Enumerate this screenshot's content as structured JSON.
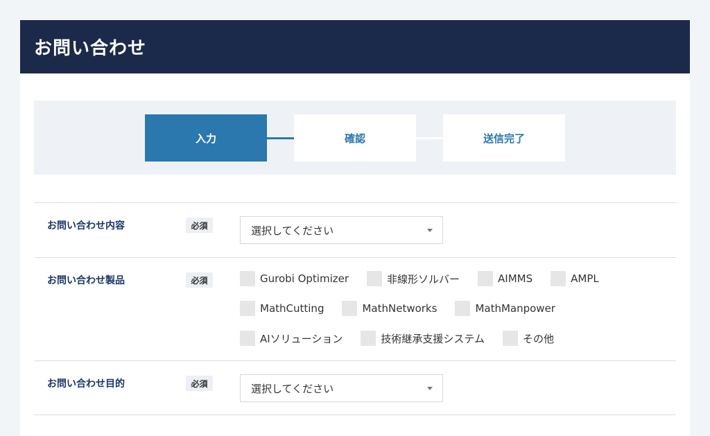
{
  "page": {
    "title": "お問い合わせ"
  },
  "colors": {
    "header_bg": "#1b2a4a",
    "accent": "#2a78ad",
    "label": "#1b3668"
  },
  "steps": [
    {
      "label": "入力",
      "active": true
    },
    {
      "label": "確認",
      "active": false
    },
    {
      "label": "送信完了",
      "active": false
    }
  ],
  "form": {
    "required_label": "必須",
    "content": {
      "label": "お問い合わせ内容",
      "select_value": "選択してください"
    },
    "products": {
      "label": "お問い合わせ製品",
      "options": [
        "Gurobi Optimizer",
        "非線形ソルバー",
        "AIMMS",
        "AMPL",
        "MathCutting",
        "MathNetworks",
        "MathManpower",
        "AIソリューション",
        "技術継承支援システム",
        "その他"
      ]
    },
    "purpose": {
      "label": "お問い合わせ目的",
      "select_value": "選択してください"
    }
  }
}
